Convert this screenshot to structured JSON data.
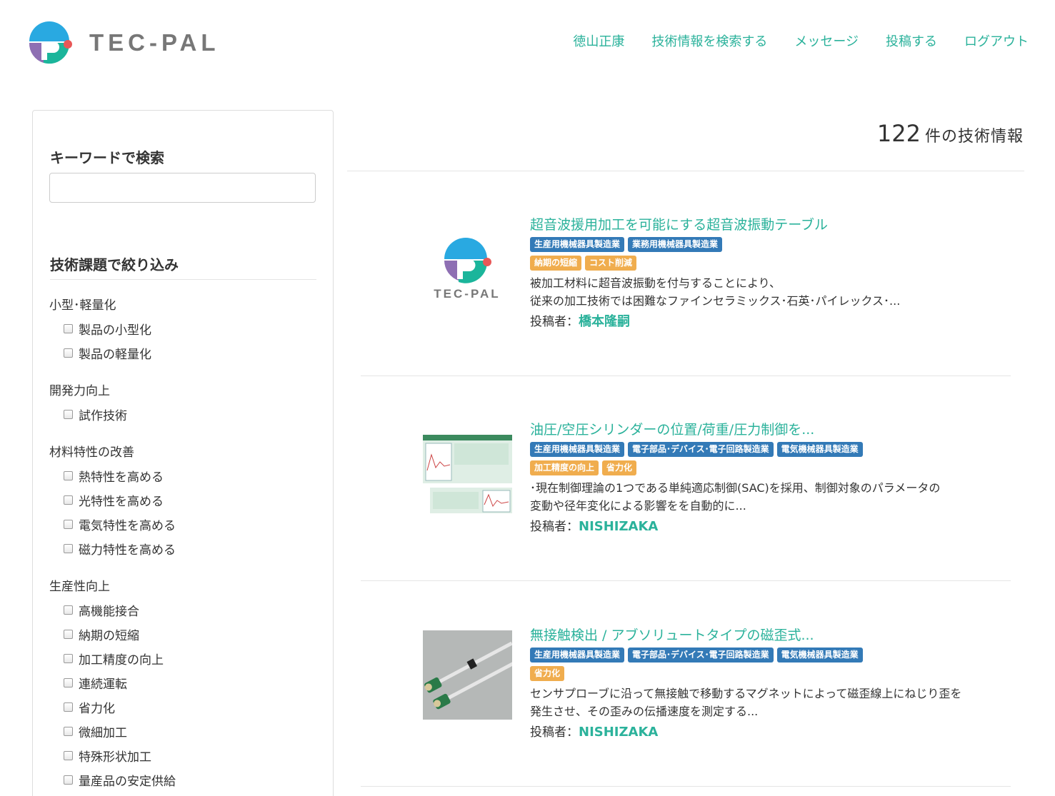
{
  "brand": {
    "name": "TEC-PAL"
  },
  "nav": [
    "徳山正康",
    "技術情報を検索する",
    "メッセージ",
    "投稿する",
    "ログアウト"
  ],
  "sidebar": {
    "keyword_title": "キーワードで検索",
    "keyword_value": "",
    "filter_title": "技術課題で絞り込み",
    "groups": [
      {
        "title": "小型･軽量化",
        "options": [
          "製品の小型化",
          "製品の軽量化"
        ]
      },
      {
        "title": "開発力向上",
        "options": [
          "試作技術"
        ]
      },
      {
        "title": "材料特性の改善",
        "options": [
          "熱特性を高める",
          "光特性を高める",
          "電気特性を高める",
          "磁力特性を高める"
        ]
      },
      {
        "title": "生産性向上",
        "options": [
          "高機能接合",
          "納期の短縮",
          "加工精度の向上",
          "連続運転",
          "省力化",
          "微細加工",
          "特殊形状加工",
          "量産品の安定供給"
        ]
      }
    ]
  },
  "results": {
    "count": "122",
    "count_label": "件の技術情報",
    "author_prefix": "投稿者：",
    "items": [
      {
        "title": "超音波援用加工を可能にする超音波振動テーブル",
        "industry_tags": [
          "生産用機械器具製造業",
          "業務用機械器具製造業"
        ],
        "issue_tags": [
          "納期の短縮",
          "コスト削減"
        ],
        "desc1": "被加工材料に超音波振動を付与することにより、",
        "desc2": "従来の加工技術では困難なファインセラミックス･石英･パイレックス･...",
        "author": "橋本隆嗣",
        "thumb": "tecpal-logo"
      },
      {
        "title": "油圧/空圧シリンダーの位置/荷重/圧力制御を...",
        "industry_tags": [
          "生産用機械器具製造業",
          "電子部品･デバイス･電子回路製造業",
          "電気機械器具製造業"
        ],
        "issue_tags": [
          "加工精度の向上",
          "省力化"
        ],
        "desc1": "･現在制御理論の1つである単純適応制御(SAC)を採用、制御対象のパラメータの",
        "desc2": "変動や径年変化による影響をを自動的に...",
        "author": "NISHIZAKA",
        "thumb": "document-image"
      },
      {
        "title": "無接触検出 / アブソリュートタイプの磁歪式...",
        "industry_tags": [
          "生産用機械器具製造業",
          "電子部品･デバイス･電子回路製造業",
          "電気機械器具製造業"
        ],
        "issue_tags": [
          "省力化"
        ],
        "desc1": "センサプローブに沿って無接触で移動するマグネットによって磁歪線上にねじり歪を",
        "desc2": "発生させ、その歪みの伝播速度を測定する...",
        "author": "NISHIZAKA",
        "thumb": "sensor-photo"
      }
    ]
  },
  "colors": {
    "accent": "#2bb29b",
    "tag_blue": "#337ab7",
    "tag_orange": "#f0ad4e"
  }
}
